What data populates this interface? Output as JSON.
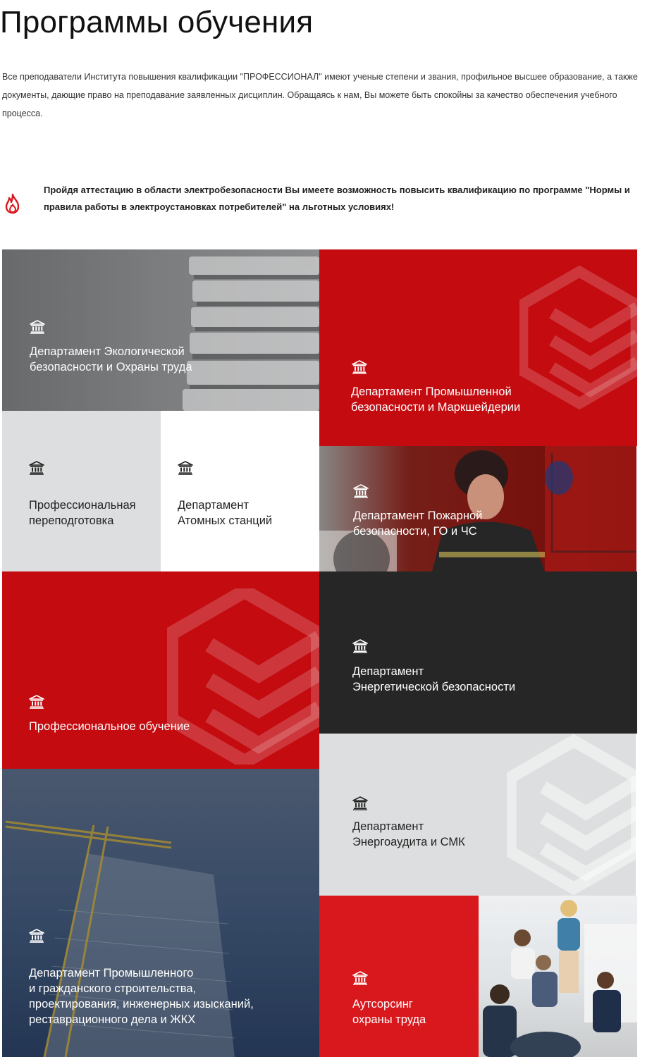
{
  "page": {
    "title": "Программы обучения",
    "intro": "Все преподаватели Института повышения квалификации \"ПРОФЕССИОНАЛ\" имеют ученые степени и звания, профильное высшее образование, а также документы, дающие право на преподавание заявленных дисциплин. Обращаясь к нам, Вы можете быть спокойны за качество обеспечения учебного процесса."
  },
  "notice": {
    "icon": "flame-icon",
    "text": "Пройдя аттестацию в области электробезопасности Вы имеете возможность повысить  квалификацию по программе \"Нормы и  правила работы в электроустановках потребителей\"  на  льготных условиях!"
  },
  "colors": {
    "accent_red": "#c30b10",
    "bright_red": "#d9181d",
    "dark": "#262626",
    "light_grey": "#dcdedf"
  },
  "tiles": [
    {
      "id": "ecology",
      "icon": "institution-icon",
      "label": "Департамент Экологической\nбезопасности и Охраны труда"
    },
    {
      "id": "industrial",
      "icon": "institution-icon",
      "label": "Департамент Промышленной\nбезопасности и Маркшейдерии"
    },
    {
      "id": "retraining",
      "icon": "institution-icon",
      "label": "Профессиональная\nпереподготовка"
    },
    {
      "id": "nuclear",
      "icon": "institution-icon",
      "label": "Департамент\nАтомных станций"
    },
    {
      "id": "fire",
      "icon": "institution-icon",
      "label": "Департамент Пожарной\nбезопасности, ГО и ЧС"
    },
    {
      "id": "training",
      "icon": "institution-icon",
      "label": "Профессиональное обучение"
    },
    {
      "id": "energy",
      "icon": "institution-icon",
      "label": "Департамент\nЭнергетической безопасности"
    },
    {
      "id": "construction",
      "icon": "institution-icon",
      "label": "Департамент Промышленного\nи гражданского строительства,\nпроектирования, инженерных изысканий,\nреставрационного дела и ЖКХ"
    },
    {
      "id": "audit",
      "icon": "institution-icon",
      "label": "Департамент\nЭнергоаудита и СМК"
    },
    {
      "id": "outsourcing",
      "icon": "institution-icon",
      "label": "Аутсорсинг\nохраны труда"
    }
  ]
}
